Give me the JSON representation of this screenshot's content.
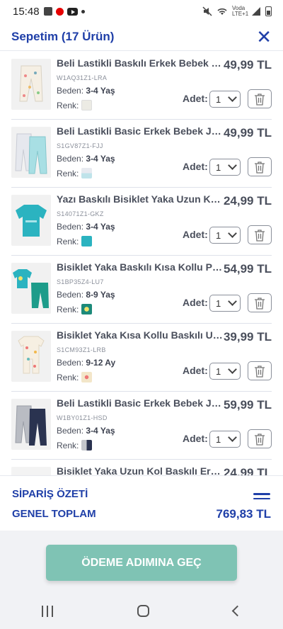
{
  "status_bar": {
    "time": "15:48",
    "carrier": "Voda LTE+1"
  },
  "header": {
    "title": "Sepetim (17 Ürün)",
    "close_icon": "close-icon"
  },
  "labels": {
    "size": "Beden:",
    "color": "Renk:",
    "qty": "Adet:"
  },
  "items": [
    {
      "name": "Beli Lastikli Baskılı Erkek Bebek Jog...",
      "code": "W1AQ31Z1-LRA",
      "size": "3-4 Yaş",
      "qty": "1",
      "price": "49,99 TL",
      "swatch": "#ecebe4"
    },
    {
      "name": "Beli Lastikli Basic Erkek Bebek Jog...",
      "code": "S1GV87Z1-FJJ",
      "size": "3-4 Yaş",
      "qty": "1",
      "price": "49,99 TL",
      "swatch": "#d8ebf0"
    },
    {
      "name": "Yazı Baskılı Bisiklet Yaka Uzun Koll...",
      "code": "S14071Z1-GKZ",
      "size": "3-4 Yaş",
      "qty": "1",
      "price": "24,99 TL",
      "swatch": "#2bb3c0"
    },
    {
      "name": "Bisiklet Yaka Baskılı Kısa Kollu Pa...",
      "code": "S1BP35Z4-LU7",
      "size": "8-9 Yaş",
      "qty": "1",
      "price": "54,99 TL",
      "swatch": "#1d8a7a"
    },
    {
      "name": "Bisiklet Yaka Kısa Kollu Baskılı Unis...",
      "code": "S1CM93Z1-LRB",
      "size": "9-12 Ay",
      "qty": "1",
      "price": "39,99 TL",
      "swatch": "#e8c98a"
    },
    {
      "name": "Beli Lastikli Basic Erkek Bebek Jog...",
      "code": "W1BY01Z1-HSD",
      "size": "3-4 Yaş",
      "qty": "1",
      "price": "59,99 TL",
      "swatch": "#2a3350"
    },
    {
      "name": "Bisiklet Yaka Uzun Kol Baskılı Erkek...",
      "code": "",
      "size": "",
      "qty": "",
      "price": "24,99 TL",
      "swatch": "#cccccc"
    }
  ],
  "summary": {
    "title": "SİPARİŞ ÖZETİ",
    "total_label": "GENEL TOPLAM",
    "total": "769,83 TL"
  },
  "checkout": {
    "label": "ÖDEME ADIMINA GEÇ"
  },
  "colors": {
    "brand": "#1f3fa8",
    "checkout": "#7fc3b4"
  }
}
